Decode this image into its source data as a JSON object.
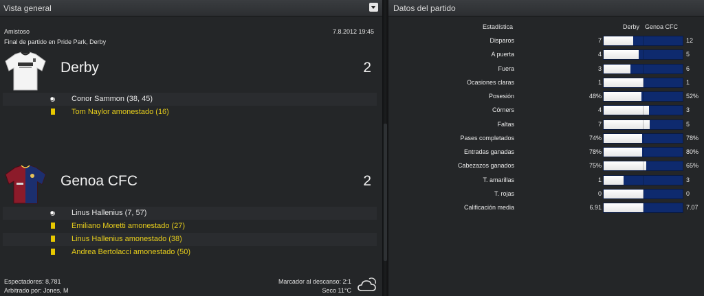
{
  "left_panel": {
    "title": "Vista general",
    "match_type": "Amistoso",
    "datetime": "7.8.2012 19:45",
    "venue": "Final de partido en Pride Park, Derby",
    "home": {
      "name": "Derby",
      "score": "2",
      "events": [
        {
          "type": "goal",
          "text": "Conor Sammon (38, 45)"
        },
        {
          "type": "yellow-card",
          "text": "Tom Naylor amonestado (16)"
        }
      ]
    },
    "away": {
      "name": "Genoa CFC",
      "score": "2",
      "events": [
        {
          "type": "goal",
          "text": "Linus Hallenius (7, 57)"
        },
        {
          "type": "yellow-card",
          "text": "Emiliano Moretti amonestado (27)"
        },
        {
          "type": "yellow-card",
          "text": "Linus Hallenius amonestado (38)"
        },
        {
          "type": "yellow-card",
          "text": "Andrea Bertolacci amonestado (50)"
        }
      ]
    },
    "footer": {
      "attendance": "Espectadores: 8,781",
      "referee": "Arbitrado por: Jones, M",
      "halftime": "Marcador al descanso: 2:1",
      "weather": "Seco 11°C"
    }
  },
  "right_panel": {
    "title": "Datos del partido",
    "header_stat": "Estadística",
    "header_home": "Derby",
    "header_away": "Genoa CFC",
    "stats": [
      {
        "label": "Disparos",
        "home": "7",
        "away": "12",
        "home_share": 0.37
      },
      {
        "label": "A puerta",
        "home": "4",
        "away": "5",
        "home_share": 0.44
      },
      {
        "label": "Fuera",
        "home": "3",
        "away": "6",
        "home_share": 0.34
      },
      {
        "label": "Ocasiones claras",
        "home": "1",
        "away": "1",
        "home_share": 0.5
      },
      {
        "label": "Posesión",
        "home": "48%",
        "away": "52%",
        "home_share": 0.48
      },
      {
        "label": "Córners",
        "home": "4",
        "away": "3",
        "home_share": 0.57
      },
      {
        "label": "Faltas",
        "home": "7",
        "away": "5",
        "home_share": 0.58
      },
      {
        "label": "Pases completados",
        "home": "74%",
        "away": "78%",
        "home_share": 0.49
      },
      {
        "label": "Entradas ganadas",
        "home": "78%",
        "away": "80%",
        "home_share": 0.49
      },
      {
        "label": "Cabezazos ganados",
        "home": "75%",
        "away": "65%",
        "home_share": 0.54
      },
      {
        "label": "T. amarillas",
        "home": "1",
        "away": "3",
        "home_share": 0.25
      },
      {
        "label": "T. rojas",
        "home": "0",
        "away": "0",
        "home_share": 0.5
      },
      {
        "label": "Calificación media",
        "home": "6.91",
        "away": "7.07",
        "home_share": 0.5
      }
    ]
  },
  "colors": {
    "home_bar": "#ffffff",
    "away_bar": "#0e2a6e",
    "card_yellow": "#e8c800",
    "event_yellow_text": "#e6cd1c"
  },
  "icons": {
    "dropdown": "chevron-down-icon",
    "goal": "ball-icon",
    "booking": "yellow-card-icon",
    "weather": "cloud-sun-icon"
  }
}
